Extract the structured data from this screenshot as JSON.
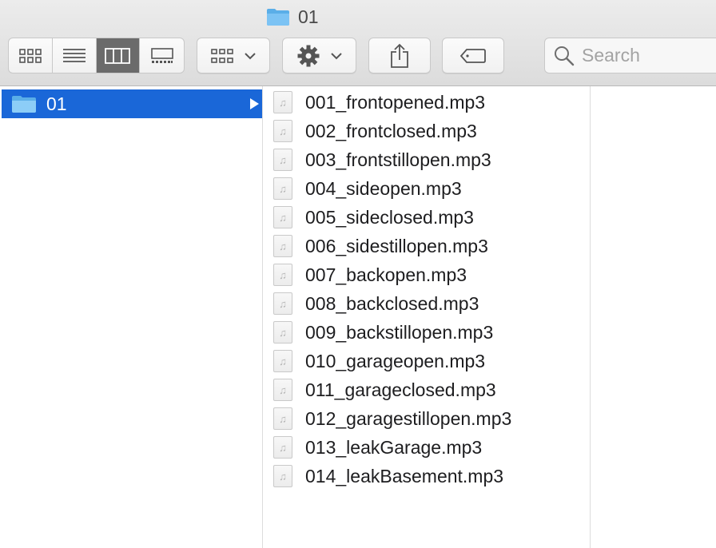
{
  "window": {
    "title": "01"
  },
  "toolbar": {
    "view_buttons": [
      "icon-view",
      "list-view",
      "column-view",
      "gallery-view"
    ],
    "active_view": "column-view",
    "group_button_icon": "group-grid-icon",
    "action_button_icon": "gear-icon",
    "share_button_icon": "share-icon",
    "tag_button_icon": "tag-icon"
  },
  "search": {
    "placeholder": "Search"
  },
  "colors": {
    "selection": "#1a67d8",
    "folder": "#6bb7f0"
  },
  "column1": {
    "items": [
      {
        "label": "01",
        "type": "folder",
        "selected": true
      }
    ]
  },
  "column2": {
    "files": [
      "001_frontopened.mp3",
      "002_frontclosed.mp3",
      "003_frontstillopen.mp3",
      "004_sideopen.mp3",
      "005_sideclosed.mp3",
      "006_sidestillopen.mp3",
      "007_backopen.mp3",
      "008_backclosed.mp3",
      "009_backstillopen.mp3",
      "010_garageopen.mp3",
      "011_garageclosed.mp3",
      "012_garagestillopen.mp3",
      "013_leakGarage.mp3",
      "014_leakBasement.mp3"
    ],
    "file_icon": "audio-file-icon"
  }
}
